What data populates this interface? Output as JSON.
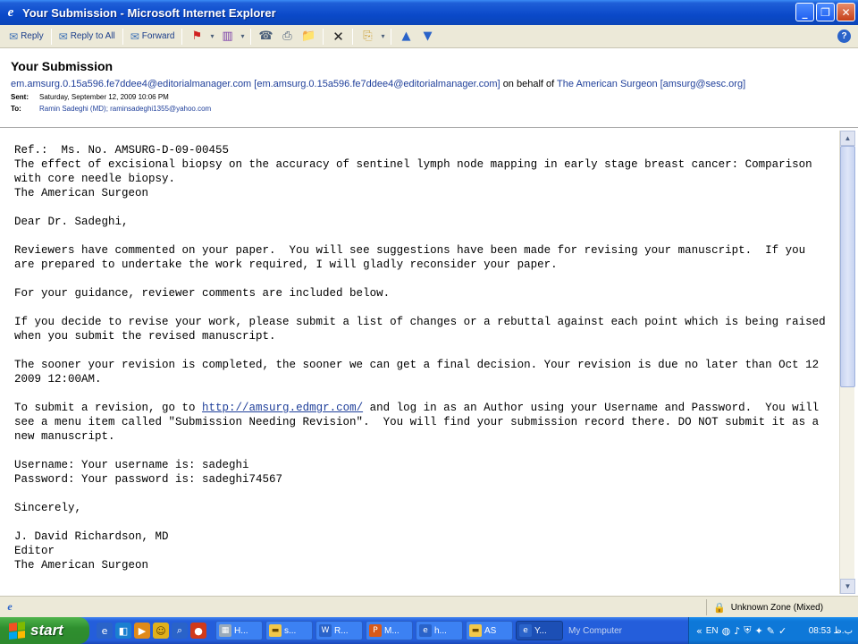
{
  "window": {
    "title": "Your Submission - Microsoft Internet Explorer"
  },
  "toolbar": {
    "reply": "Reply",
    "reply_all": "Reply to All",
    "forward": "Forward"
  },
  "email": {
    "subject": "Your Submission",
    "from_address": "em.amsurg.0.15a596.fe7ddee4@editorialmanager.com [em.amsurg.0.15a596.fe7ddee4@editorialmanager.com]",
    "on_behalf_text": "on behalf of",
    "on_behalf_name": "The American Surgeon [amsurg@sesc.org]",
    "sent_label": "Sent:",
    "sent_value": "Saturday, September 12, 2009 10:06 PM",
    "to_label": "To:",
    "to_value": "Ramin Sadeghi (MD); raminsadeghi1355@yahoo.com"
  },
  "body": {
    "ref": "Ref.:  Ms. No. AMSURG-D-09-00455",
    "title_line1": "The effect of excisional biopsy on the accuracy of sentinel lymph node mapping in early stage breast cancer: Comparison",
    "title_line2": "with core needle biopsy.",
    "journal": "The American Surgeon",
    "greeting": "Dear Dr. Sadeghi,",
    "p1_line1": "Reviewers have commented on your paper.  You will see suggestions have been made for revising your manuscript.  If you",
    "p1_line2": "are prepared to undertake the work required, I will gladly reconsider your paper.",
    "p2": "For your guidance, reviewer comments are included below.",
    "p3_line1": "If you decide to revise your work, please submit a list of changes or a rebuttal against each point which is being raised",
    "p3_line2": "when you submit the revised manuscript.",
    "p4_line1": "The sooner your revision is completed, the sooner we can get a final decision. Your revision is due no later than Oct 12",
    "p4_line2": "2009 12:00AM.",
    "p5_prefix": "To submit a revision, go to ",
    "p5_link": "http://amsurg.edmgr.com/",
    "p5_suffix": " and log in as an Author using your Username and Password.  You will",
    "p5_line2": "see a menu item called \"Submission Needing Revision\".  You will find your submission record there. DO NOT submit it as a",
    "p5_line3": "new manuscript.",
    "username": "Username: Your username is: sadeghi",
    "password": "Password: Your password is: sadeghi74567",
    "closing": "Sincerely,",
    "sig_name": "J. David Richardson, MD",
    "sig_role": "Editor",
    "sig_journal": "The American Surgeon"
  },
  "statusbar": {
    "zone": "Unknown Zone (Mixed)"
  },
  "taskbar": {
    "start": "start",
    "tasks": [
      "H...",
      "s...",
      "R...",
      "M...",
      "h...",
      "AS",
      "Y..."
    ],
    "my_computer": "My Computer",
    "lang": "EN",
    "clock": "08:53 ب.ظ"
  }
}
